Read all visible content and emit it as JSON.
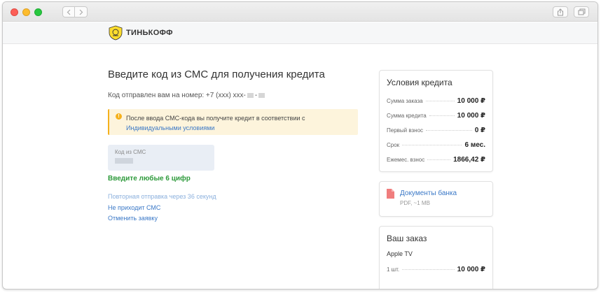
{
  "brand": {
    "name": "ТИНЬКОФФ"
  },
  "main": {
    "title": "Введите код из СМС для получения кредита",
    "sent_prefix": "Код отправлен вам на номер: +7 (xxx) xxx-",
    "notice_text": "После ввода СМС-кода вы получите кредит в соответствии с",
    "notice_link": "Индивидуальными условиями",
    "sms_label": "Код из СМС",
    "hint": "Введите любые 6 цифр",
    "resend": "Повторная отправка через 36 секунд",
    "no_sms": "Не приходит СМС",
    "cancel": "Отменить заявку"
  },
  "conditions": {
    "title": "Условия кредита",
    "rows": [
      {
        "label": "Сумма заказа",
        "value": "10 000 ₽"
      },
      {
        "label": "Сумма кредита",
        "value": "10 000 ₽"
      },
      {
        "label": "Первый взнос",
        "value": "0 ₽"
      },
      {
        "label": "Срок",
        "value": "6 мес."
      },
      {
        "label": "Ежемес. взнос",
        "value": "1866,42 ₽"
      }
    ]
  },
  "documents": {
    "title": "Документы банка",
    "meta": "PDF, ~1 MB"
  },
  "order": {
    "title": "Ваш заказ",
    "item": "Apple TV",
    "qty": "1 шт.",
    "price": "10 000 ₽"
  },
  "colors": {
    "link": "#3a78c7",
    "success": "#2d9a3b",
    "warning": "#f5b11d",
    "brand_yellow": "#ffdd2d"
  }
}
